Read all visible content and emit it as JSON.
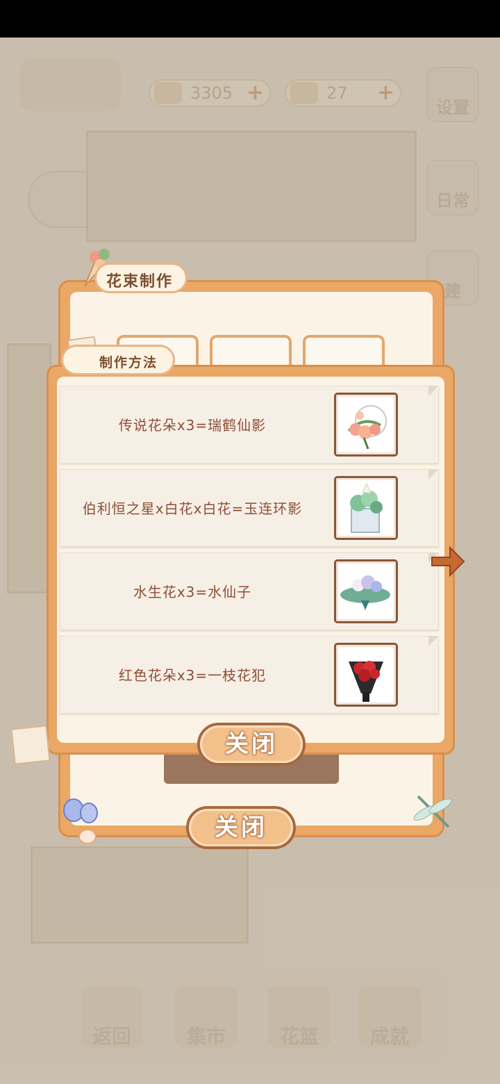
{
  "hud": {
    "fish_count": "3305",
    "cheese_count": "27",
    "settings_label": "设置",
    "daily_label": "日常",
    "build_label": "建"
  },
  "bottom_nav": [
    {
      "label": "返回"
    },
    {
      "label": "集市"
    },
    {
      "label": "花篮"
    },
    {
      "label": "成就"
    }
  ],
  "bouquet_panel": {
    "title": "花束制作",
    "close_label": "关闭"
  },
  "recipe_panel": {
    "title": "制作方法",
    "close_label": "关闭",
    "recipes": [
      {
        "text": "传说花朵x3=瑞鹤仙影",
        "thumb_icon": "peach-bouquet-icon"
      },
      {
        "text": "伯利恒之星x白花x白花=玉连环影",
        "thumb_icon": "white-lily-bouquet-icon"
      },
      {
        "text": "水生花x3=水仙子",
        "thumb_icon": "lotus-bouquet-icon"
      },
      {
        "text": "红色花朵x3=一枝花犯",
        "thumb_icon": "red-rose-bouquet-icon"
      }
    ]
  },
  "colors": {
    "panel_orange": "#eaa765",
    "panel_inner": "#fbf4e6",
    "recipe_text": "#8d4f36",
    "button_border": "#a8683f"
  }
}
